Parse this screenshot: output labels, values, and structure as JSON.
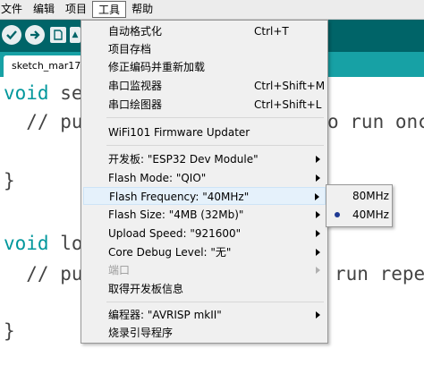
{
  "menubar": {
    "items": [
      "文件",
      "编辑",
      "项目",
      "工具",
      "帮助"
    ]
  },
  "tab": {
    "label": "sketch_mar17"
  },
  "editor": {
    "lines": [
      {
        "kw": "void",
        "rest": " set"
      },
      {
        "kw": "",
        "rest": "  // put"
      },
      {
        "kw": "",
        "rest": "}"
      },
      {
        "kw": "void",
        "rest": " loo"
      },
      {
        "kw": "",
        "rest": "  // put"
      },
      {
        "kw": "",
        "rest": "}"
      }
    ],
    "right_fragments": [
      "o run once",
      "run repea"
    ]
  },
  "tools_menu": {
    "auto_format": {
      "label": "自动格式化",
      "shortcut": "Ctrl+T"
    },
    "archive_sketch": {
      "label": "项目存档"
    },
    "fix_encoding": {
      "label": "修正编码并重新加载"
    },
    "serial_monitor": {
      "label": "串口监视器",
      "shortcut": "Ctrl+Shift+M"
    },
    "serial_plotter": {
      "label": "串口绘图器",
      "shortcut": "Ctrl+Shift+L"
    },
    "wifi_updater": {
      "label": "WiFi101 Firmware Updater"
    },
    "board": {
      "label": "开发板: \"ESP32 Dev Module\""
    },
    "flash_mode": {
      "label": "Flash Mode: \"QIO\""
    },
    "flash_frequency": {
      "label": "Flash Frequency: \"40MHz\""
    },
    "flash_size": {
      "label": "Flash Size: \"4MB (32Mb)\""
    },
    "upload_speed": {
      "label": "Upload Speed: \"921600\""
    },
    "core_debug": {
      "label": "Core Debug Level: \"无\""
    },
    "port": {
      "label": "端口"
    },
    "board_info": {
      "label": "取得开发板信息"
    },
    "programmer": {
      "label": "编程器: \"AVRISP mkII\""
    },
    "burn_bootloader": {
      "label": "烧录引导程序"
    }
  },
  "flash_freq_submenu": {
    "options": [
      {
        "label": "80MHz",
        "selected": false
      },
      {
        "label": "40MHz",
        "selected": true
      }
    ]
  }
}
